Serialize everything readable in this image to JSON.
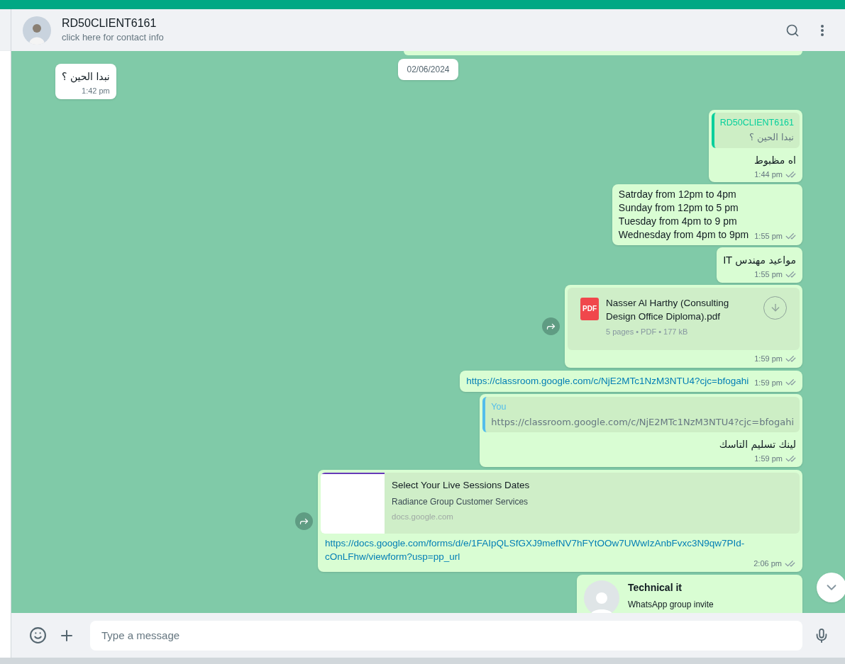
{
  "header": {
    "name": "RD50CLIENT6161",
    "subtitle": "click here for contact info"
  },
  "date_chip": "02/06/2024",
  "messages": [
    {
      "kind": "partial",
      "outgoing": true
    },
    {
      "kind": "text",
      "outgoing": false,
      "text": "نبدا الحين ؟",
      "time": "1:42 pm"
    },
    {
      "kind": "text",
      "outgoing": true,
      "quote": {
        "author": "RD50CLIENT6161",
        "text": "نبدا الحين ؟",
        "color": "#06cf9c"
      },
      "text": "اه مظبوط",
      "time": "1:44 pm"
    },
    {
      "kind": "lines",
      "outgoing": true,
      "lines": [
        "Satrday from 12pm to 4pm",
        "Sunday from 12pm to 5 pm",
        "Tuesday from 4pm to 9 pm",
        "Wednesday from 4pm to 9pm"
      ],
      "time": "1:55 pm"
    },
    {
      "kind": "text",
      "outgoing": true,
      "text": "مواعيد مهندس IT",
      "time": "1:55 pm"
    },
    {
      "kind": "file",
      "outgoing": true,
      "file_icon": "PDF",
      "file_name": "Nasser Al Harthy (Consulting Design Office Diploma).pdf",
      "meta": "5 pages • PDF • 177 kB",
      "time": "1:59 pm"
    },
    {
      "kind": "link",
      "outgoing": true,
      "text": "https://classroom.google.com/c/NjE2MTc1NzM3NTU4?cjc=bfogahi",
      "time": "1:59 pm"
    },
    {
      "kind": "text",
      "outgoing": true,
      "quote": {
        "author": "You",
        "text": "https://classroom.google.com/c/NjE2MTc1NzM3NTU4?cjc=bfogahi",
        "color": "#53bdeb"
      },
      "text": "لينك تسليم التاسك",
      "time": "1:59 pm"
    },
    {
      "kind": "link_preview",
      "outgoing": true,
      "title": "Select Your Live Sessions Dates",
      "description": "Radiance Group Customer Services",
      "domain": "docs.google.com",
      "url": "https://docs.google.com/forms/d/e/1FAIpQLSfGXJ9mefNV7hFYtOOw7UWwIzAnbFvxc3N9qw7PId-cOnLFhw/viewform?usp=pp_url",
      "time": "2:06 pm"
    },
    {
      "kind": "group_invite",
      "outgoing": true,
      "title": "Technical it",
      "subtitle": "WhatsApp group invite"
    }
  ],
  "composer": {
    "placeholder": "Type a message"
  }
}
